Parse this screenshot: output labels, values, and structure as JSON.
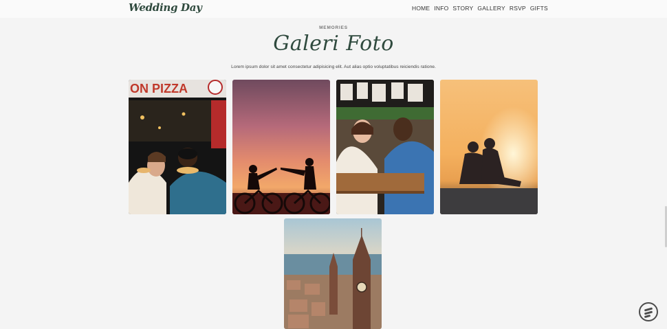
{
  "nav": {
    "brand": "Wedding Day",
    "items": [
      "HOME",
      "INFO",
      "STORY",
      "GALLERY",
      "RSVP",
      "GIFTS"
    ]
  },
  "gallery": {
    "eyebrow": "MEMORIES",
    "title": "Galeri Foto",
    "description": "Lorem ipsum dolor sit amet consectetur adipisicing elit. Aut alias optio voluptatibus reiciendis ratione.",
    "photos": [
      {
        "sign": "ON PIZZA"
      },
      {
        "sign": ""
      },
      {
        "sign": ""
      },
      {
        "sign": ""
      },
      {
        "sign": ""
      }
    ]
  },
  "colors": {
    "accent": "#2f4a3e",
    "background": "#f4f4f4"
  }
}
